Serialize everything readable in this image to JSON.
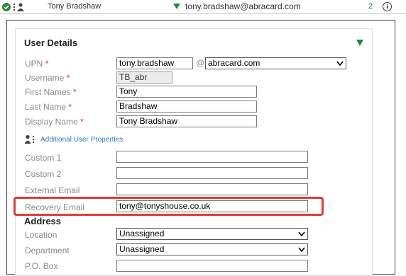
{
  "topbar": {
    "check_icon": "check-circle-icon",
    "user_icon": "user-hierarchy-icon",
    "name": "Tony Bradshaw",
    "email": "tony.bradshaw@abracard.com",
    "count": "2",
    "info_icon": "info-icon"
  },
  "section": {
    "title": "User Details"
  },
  "fields": {
    "upn": {
      "label": "UPN",
      "value": "tony.bradshaw",
      "at": "@",
      "domain": "abracard.com"
    },
    "username": {
      "label": "Username",
      "value": "TB_abr"
    },
    "first_names": {
      "label": "First Names",
      "value": "Tony"
    },
    "last_name": {
      "label": "Last Name",
      "value": "Bradshaw"
    },
    "display_name": {
      "label": "Display Name",
      "value": "Tony Bradshaw"
    }
  },
  "required_marker": "*",
  "additional": {
    "link": "Additional User Properties"
  },
  "custom": {
    "custom1": {
      "label": "Custom 1",
      "value": ""
    },
    "custom2": {
      "label": "Custom 2",
      "value": ""
    },
    "external_email": {
      "label": "External Email",
      "value": ""
    },
    "recovery_email": {
      "label": "Recovery Email",
      "value": "tony@tonyshouse.co.uk"
    }
  },
  "address": {
    "title": "Address",
    "location": {
      "label": "Location",
      "value": "Unassigned"
    },
    "department": {
      "label": "Department",
      "value": "Unassigned"
    },
    "po_box": {
      "label": "P.O. Box",
      "value": ""
    }
  },
  "colors": {
    "accent_green": "#1e8a3a",
    "link_blue": "#2f7bbd",
    "required_red": "#d32f2f",
    "highlight_red": "#e03b3b"
  }
}
